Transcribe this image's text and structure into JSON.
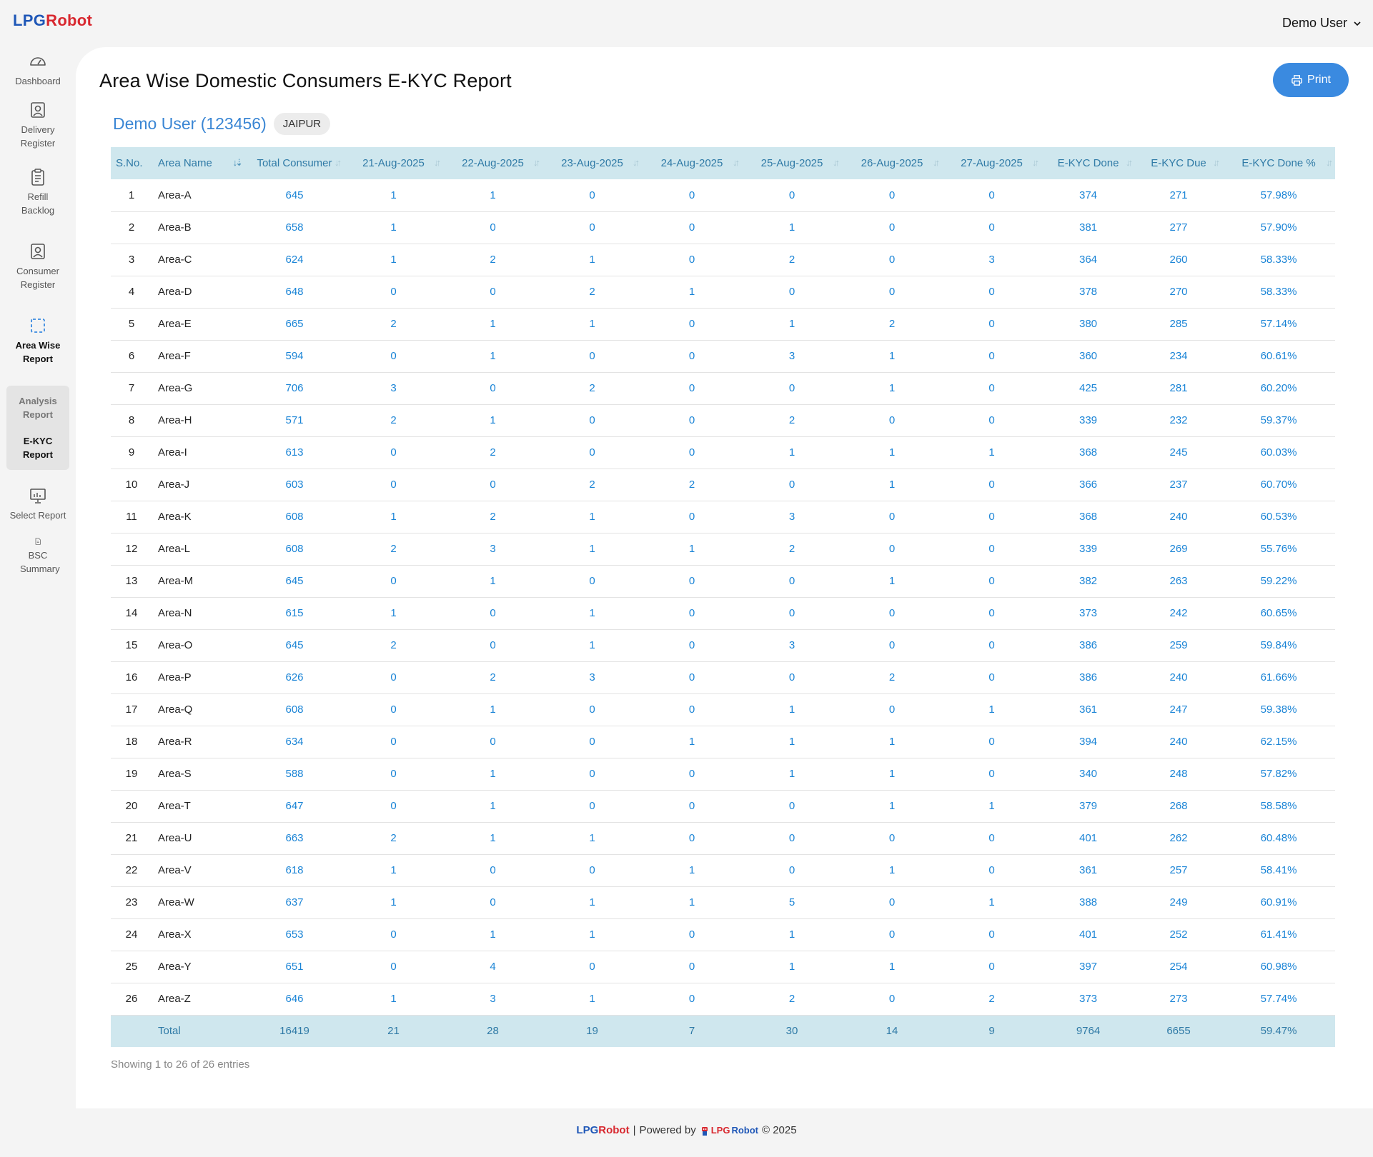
{
  "app": {
    "logo_lpg": "LPG",
    "logo_robot": "Robot",
    "user_menu": "Demo User"
  },
  "sidebar": {
    "items": [
      {
        "label": "Dashboard",
        "icon": "gauge-icon"
      },
      {
        "label": "Delivery Register",
        "icon": "user-card-icon"
      },
      {
        "label": "Refill Backlog",
        "icon": "clipboard-icon"
      },
      {
        "label": "Consumer Register",
        "icon": "user-badge-icon"
      },
      {
        "label": "Area Wise Report",
        "icon": "dashed-square-icon"
      },
      {
        "label": "Analysis Report"
      },
      {
        "label": "E-KYC Report"
      },
      {
        "label": "Select Report",
        "icon": "presentation-chart-icon"
      },
      {
        "label": "BSC Summary",
        "icon": "document-icon"
      }
    ]
  },
  "page": {
    "title": "Area Wise Domestic Consumers E-KYC Report",
    "print_label": "Print",
    "user_name": "Demo User (123456)",
    "city": "JAIPUR",
    "showing": "Showing 1 to 26 of 26 entries"
  },
  "table": {
    "headers": [
      "S.No.",
      "Area Name",
      "Total Consumer",
      "21-Aug-2025",
      "22-Aug-2025",
      "23-Aug-2025",
      "24-Aug-2025",
      "25-Aug-2025",
      "26-Aug-2025",
      "27-Aug-2025",
      "E-KYC Done",
      "E-KYC Due",
      "E-KYC Done %"
    ],
    "rows": [
      [
        "1",
        "Area-A",
        "645",
        "1",
        "1",
        "0",
        "0",
        "0",
        "0",
        "0",
        "374",
        "271",
        "57.98%"
      ],
      [
        "2",
        "Area-B",
        "658",
        "1",
        "0",
        "0",
        "0",
        "1",
        "0",
        "0",
        "381",
        "277",
        "57.90%"
      ],
      [
        "3",
        "Area-C",
        "624",
        "1",
        "2",
        "1",
        "0",
        "2",
        "0",
        "3",
        "364",
        "260",
        "58.33%"
      ],
      [
        "4",
        "Area-D",
        "648",
        "0",
        "0",
        "2",
        "1",
        "0",
        "0",
        "0",
        "378",
        "270",
        "58.33%"
      ],
      [
        "5",
        "Area-E",
        "665",
        "2",
        "1",
        "1",
        "0",
        "1",
        "2",
        "0",
        "380",
        "285",
        "57.14%"
      ],
      [
        "6",
        "Area-F",
        "594",
        "0",
        "1",
        "0",
        "0",
        "3",
        "1",
        "0",
        "360",
        "234",
        "60.61%"
      ],
      [
        "7",
        "Area-G",
        "706",
        "3",
        "0",
        "2",
        "0",
        "0",
        "1",
        "0",
        "425",
        "281",
        "60.20%"
      ],
      [
        "8",
        "Area-H",
        "571",
        "2",
        "1",
        "0",
        "0",
        "2",
        "0",
        "0",
        "339",
        "232",
        "59.37%"
      ],
      [
        "9",
        "Area-I",
        "613",
        "0",
        "2",
        "0",
        "0",
        "1",
        "1",
        "1",
        "368",
        "245",
        "60.03%"
      ],
      [
        "10",
        "Area-J",
        "603",
        "0",
        "0",
        "2",
        "2",
        "0",
        "1",
        "0",
        "366",
        "237",
        "60.70%"
      ],
      [
        "11",
        "Area-K",
        "608",
        "1",
        "2",
        "1",
        "0",
        "3",
        "0",
        "0",
        "368",
        "240",
        "60.53%"
      ],
      [
        "12",
        "Area-L",
        "608",
        "2",
        "3",
        "1",
        "1",
        "2",
        "0",
        "0",
        "339",
        "269",
        "55.76%"
      ],
      [
        "13",
        "Area-M",
        "645",
        "0",
        "1",
        "0",
        "0",
        "0",
        "1",
        "0",
        "382",
        "263",
        "59.22%"
      ],
      [
        "14",
        "Area-N",
        "615",
        "1",
        "0",
        "1",
        "0",
        "0",
        "0",
        "0",
        "373",
        "242",
        "60.65%"
      ],
      [
        "15",
        "Area-O",
        "645",
        "2",
        "0",
        "1",
        "0",
        "3",
        "0",
        "0",
        "386",
        "259",
        "59.84%"
      ],
      [
        "16",
        "Area-P",
        "626",
        "0",
        "2",
        "3",
        "0",
        "0",
        "2",
        "0",
        "386",
        "240",
        "61.66%"
      ],
      [
        "17",
        "Area-Q",
        "608",
        "0",
        "1",
        "0",
        "0",
        "1",
        "0",
        "1",
        "361",
        "247",
        "59.38%"
      ],
      [
        "18",
        "Area-R",
        "634",
        "0",
        "0",
        "0",
        "1",
        "1",
        "1",
        "0",
        "394",
        "240",
        "62.15%"
      ],
      [
        "19",
        "Area-S",
        "588",
        "0",
        "1",
        "0",
        "0",
        "1",
        "1",
        "0",
        "340",
        "248",
        "57.82%"
      ],
      [
        "20",
        "Area-T",
        "647",
        "0",
        "1",
        "0",
        "0",
        "0",
        "1",
        "1",
        "379",
        "268",
        "58.58%"
      ],
      [
        "21",
        "Area-U",
        "663",
        "2",
        "1",
        "1",
        "0",
        "0",
        "0",
        "0",
        "401",
        "262",
        "60.48%"
      ],
      [
        "22",
        "Area-V",
        "618",
        "1",
        "0",
        "0",
        "1",
        "0",
        "1",
        "0",
        "361",
        "257",
        "58.41%"
      ],
      [
        "23",
        "Area-W",
        "637",
        "1",
        "0",
        "1",
        "1",
        "5",
        "0",
        "1",
        "388",
        "249",
        "60.91%"
      ],
      [
        "24",
        "Area-X",
        "653",
        "0",
        "1",
        "1",
        "0",
        "1",
        "0",
        "0",
        "401",
        "252",
        "61.41%"
      ],
      [
        "25",
        "Area-Y",
        "651",
        "0",
        "4",
        "0",
        "0",
        "1",
        "1",
        "0",
        "397",
        "254",
        "60.98%"
      ],
      [
        "26",
        "Area-Z",
        "646",
        "1",
        "3",
        "1",
        "0",
        "2",
        "0",
        "2",
        "373",
        "273",
        "57.74%"
      ]
    ],
    "total": [
      "",
      "Total",
      "16419",
      "21",
      "28",
      "19",
      "7",
      "30",
      "14",
      "9",
      "9764",
      "6655",
      "59.47%"
    ]
  },
  "footer": {
    "brand_lpg": "LPG",
    "brand_robot": "Robot",
    "separator": "|",
    "powered_by": "Powered by",
    "small_lpg": "LPG",
    "small_robot": "Robot",
    "copyright": "© 2025"
  },
  "colors": {
    "accent": "#3a8ae0",
    "header_bg": "#cfe7ee",
    "value_blue": "#1a84d6",
    "logo_blue": "#1f57b7",
    "logo_red": "#d8282f"
  }
}
